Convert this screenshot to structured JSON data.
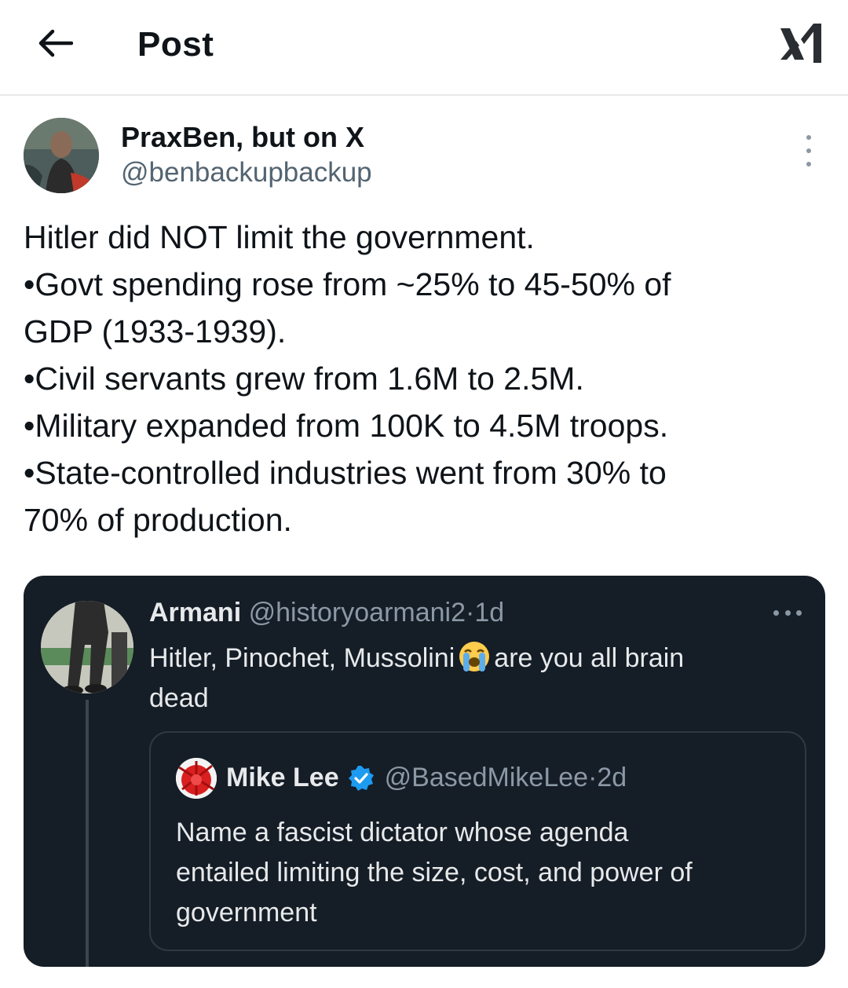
{
  "header": {
    "title": "Post",
    "back_icon": "arrow-left-icon",
    "logo_icon": "x-logo-icon"
  },
  "post": {
    "author_name": "PraxBen, but on X",
    "author_handle": "@benbackupbackup",
    "more_icon": "more-vertical-icon",
    "lines": [
      "Hitler did NOT limit the government.",
      "•Govt spending rose from ~25% to 45-50% of",
      "GDP (1933-1939).",
      "•Civil servants grew from 1.6M to 2.5M.",
      "•Military expanded from 100K to 4.5M troops.",
      "•State-controlled industries went from 30% to",
      "70% of production."
    ]
  },
  "quote": {
    "author_name": "Armani",
    "author_handle": "@historyoarmani2",
    "separator": "·",
    "time": "1d",
    "more_icon": "more-horizontal-icon",
    "text_before_emoji": "Hitler, Pinochet, Mussolini",
    "emoji": "loudly-crying-face-emoji",
    "text_after_emoji": "are you all brain",
    "text_line2": "dead",
    "nested": {
      "author_name": "Mike Lee",
      "verified_icon": "verified-badge-icon",
      "author_handle": "@BasedMikeLee",
      "separator": "·",
      "time": "2d",
      "lines": [
        "Name a fascist dictator whose agenda",
        "entailed limiting the size, cost, and power of",
        "government"
      ]
    }
  },
  "colors": {
    "quote_bg": "#151d27",
    "secondary_text": "#536471",
    "verified_blue": "#1d9bf0"
  }
}
